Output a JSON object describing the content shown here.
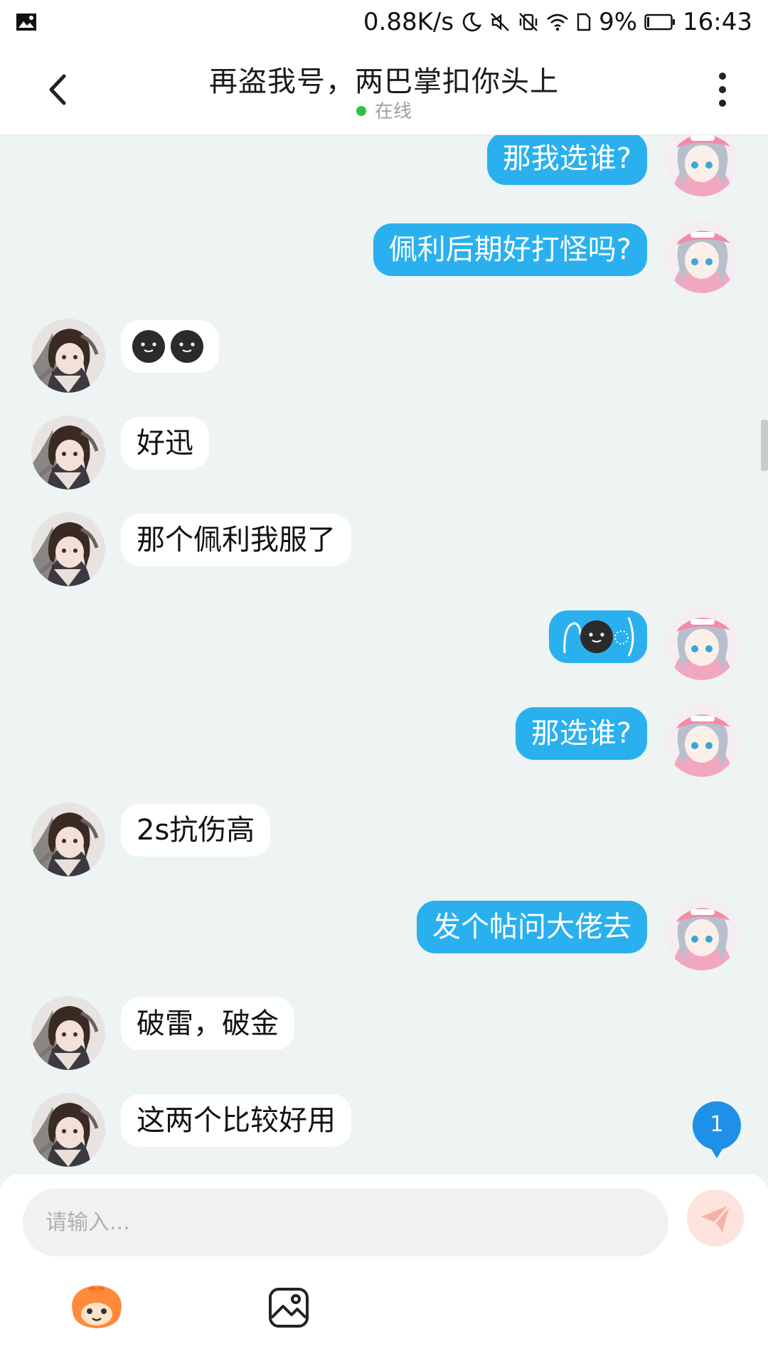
{
  "status_bar": {
    "net_speed": "0.88K/s",
    "battery": "9%",
    "time": "16:43"
  },
  "header": {
    "title": "再盗我号，两巴掌扣你头上",
    "status": "在线"
  },
  "messages": [
    {
      "side": "me",
      "text": "那我选谁?"
    },
    {
      "side": "me",
      "text": "佩利后期好打怪吗?"
    },
    {
      "side": "other",
      "type": "emoji"
    },
    {
      "side": "other",
      "text": "好迅"
    },
    {
      "side": "other",
      "text": "那个佩利我服了"
    },
    {
      "side": "me",
      "type": "emoji"
    },
    {
      "side": "me",
      "text": "那选谁?"
    },
    {
      "side": "other",
      "text": "2s抗伤高"
    },
    {
      "side": "me",
      "text": "发个帖问大佬去"
    },
    {
      "side": "other",
      "text": "破雷，破金"
    },
    {
      "side": "other",
      "text": "这两个比较好用"
    }
  ],
  "unread_count": "1",
  "input": {
    "placeholder": "请输入..."
  },
  "colors": {
    "my_bubble": "#2ab0ee",
    "other_bubble": "#ffffff",
    "background": "#eef3f3",
    "online": "#2bc43a"
  },
  "icons": [
    "back-arrow-icon",
    "more-vertical-icon",
    "send-icon",
    "sticker-icon",
    "image-icon"
  ]
}
